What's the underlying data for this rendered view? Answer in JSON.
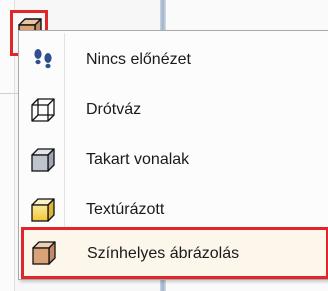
{
  "menu": {
    "items": [
      {
        "label": "Nincs előnézet",
        "icon": "footprints-icon"
      },
      {
        "label": "Drótváz",
        "icon": "wireframe-cube-icon"
      },
      {
        "label": "Takart vonalak",
        "icon": "hidden-lines-cube-icon"
      },
      {
        "label": "Textúrázott",
        "icon": "textured-cube-icon"
      },
      {
        "label": "Színhelyes ábrázolás",
        "icon": "shaded-cube-icon",
        "selected": true
      }
    ]
  },
  "colors": {
    "highlight_border": "#e0262b",
    "footprint_blue": "#2f4f8f",
    "cube_gray": "#bfc3cc",
    "cube_yellow": "#f2d35a",
    "cube_tan": "#d9a37a"
  }
}
